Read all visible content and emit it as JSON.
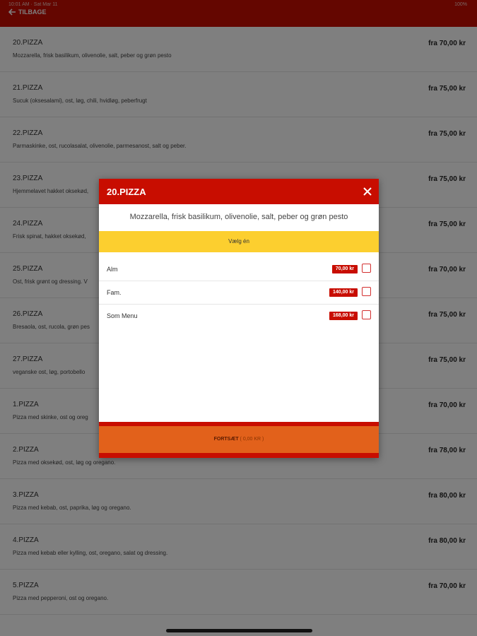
{
  "status_bar": {
    "left": "10:01 AM · Sat Mar 11",
    "right": "100%"
  },
  "header": {
    "back_label": "TILBAGE"
  },
  "menu_items": [
    {
      "name": "20.PIZZA",
      "desc": "Mozzarella, frisk basilikum, olivenolie, salt, peber og grøn pesto",
      "price": "fra 70,00 kr"
    },
    {
      "name": "21.PIZZA",
      "desc": "Sucuk (oksesalami), ost, løg, chili, hvidløg, peberfrugt",
      "price": "fra 75,00 kr"
    },
    {
      "name": "22.PIZZA",
      "desc": "Parmaskinke, ost, rucolasalat, olivenolie, parmesanost, salt og peber.",
      "price": "fra 75,00 kr"
    },
    {
      "name": "23.PIZZA",
      "desc": "Hjemmelavet hakket oksekød,",
      "price": "fra 75,00 kr"
    },
    {
      "name": "24.PIZZA",
      "desc": "Frisk spinat, hakket oksekød,",
      "price": "fra 75,00 kr"
    },
    {
      "name": "25.PIZZA",
      "desc": "Ost, frisk grønt og dressing. V",
      "price": "fra 70,00 kr"
    },
    {
      "name": "26.PIZZA",
      "desc": "Bresaola, ost, rucola, grøn pes",
      "price": "fra 75,00 kr"
    },
    {
      "name": "27.PIZZA",
      "desc": "veganske ost, løg, portobello",
      "price": "fra 75,00 kr"
    },
    {
      "name": "1.PIZZA",
      "desc": "Pizza med skinke, ost og oreg",
      "price": "fra 70,00 kr"
    },
    {
      "name": "2.PIZZA",
      "desc": "Pizza med oksekød, ost, løg og oregano.",
      "price": "fra 78,00 kr"
    },
    {
      "name": "3.PIZZA",
      "desc": "Pizza med kebab, ost, paprika, løg og oregano.",
      "price": "fra 80,00 kr"
    },
    {
      "name": "4.PIZZA",
      "desc": "Pizza med kebab eller kylling, ost, oregano, salat og dressing.",
      "price": "fra 80,00 kr"
    },
    {
      "name": "5.PIZZA",
      "desc": "Pizza med pepperoni, ost og oregano.",
      "price": "fra 70,00 kr"
    }
  ],
  "modal": {
    "title": "20.PIZZA",
    "description": "Mozzarella, frisk basilikum, olivenolie, salt, peber og grøn pesto",
    "choose_label": "Vælg én",
    "options": [
      {
        "label": "Alm",
        "price": "70,00 kr"
      },
      {
        "label": "Fam.",
        "price": "140,00 kr"
      },
      {
        "label": "Som Menu",
        "price": "168,00 kr"
      }
    ],
    "continue_label": "FORTSÆT",
    "continue_amount": "( 0,00 KR )"
  },
  "colors": {
    "brand_red": "#c80d00",
    "accent_yellow": "#fccf2f",
    "continue_orange": "#e2611b"
  }
}
